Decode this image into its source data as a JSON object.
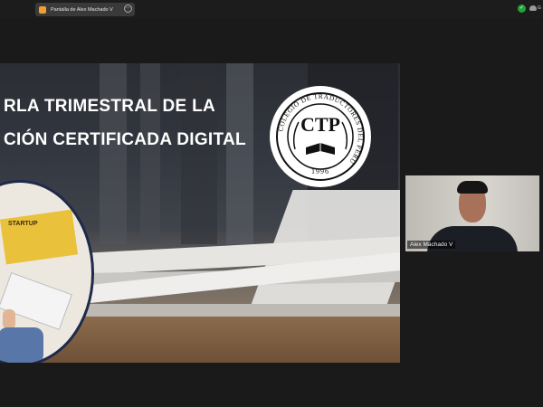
{
  "topbar": {
    "share_label": "Pantalla de Alex Machado V",
    "more_glyph": "⋯",
    "share_icon": "zoom-share-icon",
    "right_cut_text": "G"
  },
  "slide": {
    "title_line1": "RLA TRIMESTRAL DE LA",
    "title_line2": "CIÓN CERTIFICADA DIGITAL",
    "book_label": "STARTUP",
    "seal": {
      "ring_text": "COLEGIO DE TRADUCTORES DEL PERÚ",
      "monogram": "CTP",
      "year": "1996"
    }
  },
  "participant": {
    "name": "Alex Machado V"
  },
  "colors": {
    "background": "#1a1a1a",
    "secure_green": "#23a33a",
    "zoom_orange": "#f0a030"
  }
}
